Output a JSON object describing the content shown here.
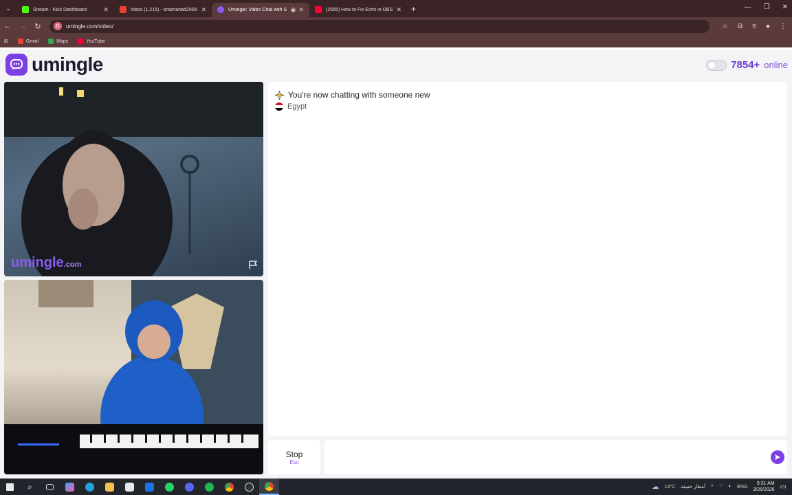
{
  "browser": {
    "tabs": [
      {
        "title": "Stream - Kick Dashboard",
        "color": "#53fc18"
      },
      {
        "title": "Inbox (1,215) - omartahad2008",
        "color": "#ea4335"
      },
      {
        "title": "Umingle: Video Chat with S",
        "color": "#8a5cf0",
        "active": true
      },
      {
        "title": "(2555) How to Fix Echo in OBS",
        "color": "#ff0033"
      }
    ],
    "new_tab": "+",
    "url": "umingle.com/video/",
    "bookmarks": [
      {
        "label": "Gmail",
        "color": "#ea4335"
      },
      {
        "label": "Maps",
        "color": "#34a853"
      },
      {
        "label": "YouTube",
        "color": "#ff0033"
      }
    ]
  },
  "header": {
    "logo_text": "umingle",
    "online_count": "7854+",
    "online_label": "online"
  },
  "video": {
    "watermark_main": "umingle",
    "watermark_domain": ".com"
  },
  "chat": {
    "status_message": "You're now chatting with someone new",
    "country": "Egypt"
  },
  "controls": {
    "stop_label": "Stop",
    "stop_shortcut": "Esc",
    "message_placeholder": ""
  },
  "taskbar": {
    "weather": "13°C",
    "weather_text": "أمطار خفيفة",
    "language": "ENG",
    "time": "9:31 AM",
    "date": "3/25/2026"
  },
  "colors": {
    "brand": "#7b3fe4",
    "online_count": "#6c3bd6"
  }
}
